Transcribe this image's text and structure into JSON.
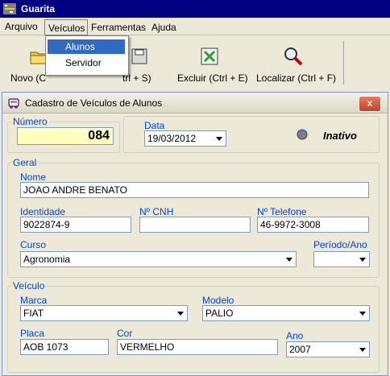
{
  "app": {
    "title": "Guarita"
  },
  "menu": {
    "items": [
      "Arquivo",
      "Veículos",
      "Ferramentas",
      "Ajuda"
    ]
  },
  "toolbar": {
    "novo_label": "Novo (C",
    "salvar_label": "trl + S)",
    "excluir_label": "Excluir (Ctrl + E)",
    "localizar_label": "Localizar (Ctrl + F)"
  },
  "dropdown": {
    "items": [
      "Alunos",
      "Servidor"
    ]
  },
  "window": {
    "title": "Cadastro de Veículos de Alunos",
    "close_label": "x"
  },
  "numero": {
    "legend": "Número",
    "value": "084"
  },
  "data": {
    "label": "Data",
    "value": "19/03/2012"
  },
  "status": {
    "text": "Inativo"
  },
  "geral": {
    "legend": "Geral",
    "nome_label": "Nome",
    "nome_value": "JOAO ANDRE BENATO",
    "identidade_label": "Identidade",
    "identidade_value": "9022874-9",
    "cnh_label": "Nº CNH",
    "cnh_value": "",
    "telefone_label": "Nº Telefone",
    "telefone_value": "46-9972-3008",
    "curso_label": "Curso",
    "curso_value": "Agronomia",
    "periodo_label": "Período/Ano",
    "periodo_value": ""
  },
  "veiculo": {
    "legend": "Veículo",
    "marca_label": "Marca",
    "marca_value": "FIAT",
    "modelo_label": "Modelo",
    "modelo_value": "PALIO",
    "placa_label": "Placa",
    "placa_value": "AOB 1073",
    "cor_label": "Cor",
    "cor_value": "VERMELHO",
    "ano_label": "Ano",
    "ano_value": "2007"
  }
}
